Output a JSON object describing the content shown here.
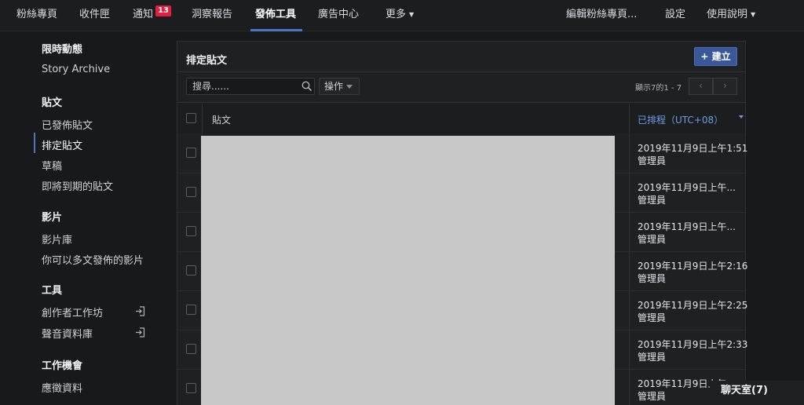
{
  "nav": {
    "items": [
      {
        "label": "粉絲專頁"
      },
      {
        "label": "收件匣"
      },
      {
        "label": "通知",
        "badge": "13"
      },
      {
        "label": "洞察報告"
      },
      {
        "label": "發佈工具",
        "active": true
      },
      {
        "label": "廣告中心"
      },
      {
        "label": "更多"
      }
    ],
    "right": [
      {
        "label": "編輯粉絲專頁..."
      },
      {
        "label": "設定"
      },
      {
        "label": "使用說明"
      }
    ]
  },
  "sidebar": {
    "sections": [
      {
        "heading": "限時動態",
        "items": [
          "Story Archive"
        ]
      },
      {
        "heading": "貼文",
        "items": [
          "已發佈貼文",
          "排定貼文",
          "草稿",
          "即將到期的貼文"
        ]
      },
      {
        "heading": "影片",
        "items": [
          "影片庫",
          "你可以多文發佈的影片"
        ]
      },
      {
        "heading": "工具",
        "items": [
          "創作者工作坊",
          "聲音資料庫"
        ]
      },
      {
        "heading": "工作機會",
        "items": [
          "應徵資料"
        ]
      }
    ]
  },
  "panel": {
    "title": "排定貼文",
    "create_label": "建立",
    "search_placeholder": "搜尋......",
    "action_label": "操作",
    "count_label": "顯示7的1 - 7",
    "prev_symbol": "‹",
    "next_symbol": "›"
  },
  "table": {
    "col_post": "貼文",
    "col_scheduled": "已排程（UTC+08）",
    "rows": [
      {
        "date": "2019年11月9日上午1:51",
        "author": "管理員"
      },
      {
        "date": "2019年11月9日上午...",
        "author": "管理員"
      },
      {
        "date": "2019年11月9日上午...",
        "author": "管理員"
      },
      {
        "date": "2019年11月9日上午2:16",
        "author": "管理員"
      },
      {
        "date": "2019年11月9日上午2:25",
        "author": "管理員"
      },
      {
        "date": "2019年11月9日上午2:33",
        "author": "管理員"
      },
      {
        "date": "2019年11月9日上午",
        "author": "管理員"
      }
    ]
  },
  "chat": {
    "label": "聊天室(7)"
  },
  "colors": {
    "accent": "#4a76c7",
    "badge": "#e41e3f",
    "button": "#385898",
    "link": "#6d9be8"
  }
}
